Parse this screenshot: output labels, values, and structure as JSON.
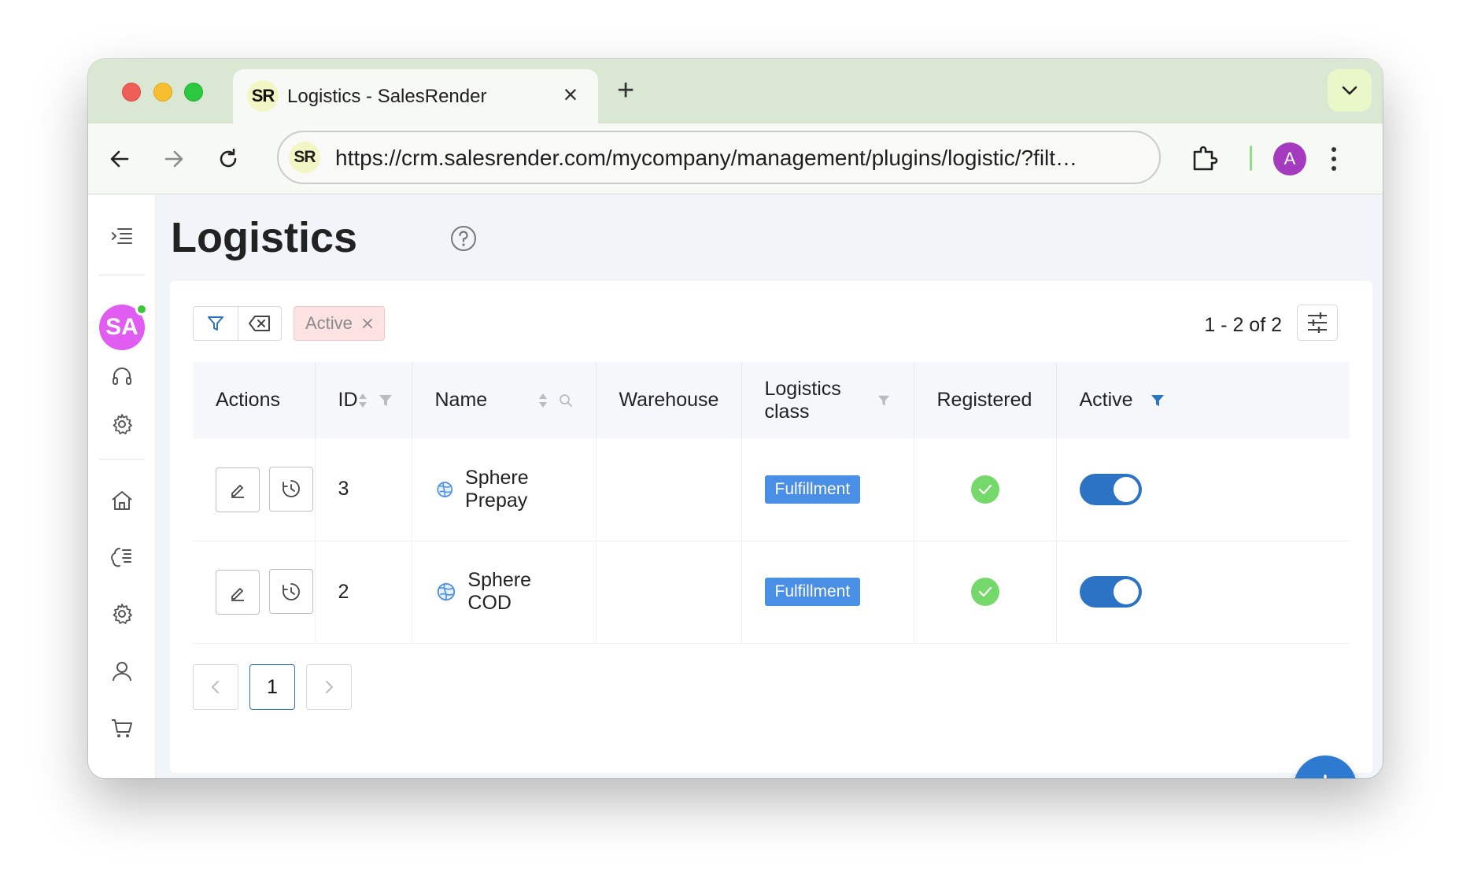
{
  "browser": {
    "tab": {
      "favicon_text": "SR",
      "title": "Logistics - SalesRender"
    },
    "new_tab_symbol": "+",
    "close_symbol": "×",
    "address": {
      "favicon_text": "SR",
      "url": "https://crm.salesrender.com/mycompany/management/plugins/logistic/?filt…"
    },
    "profile_initial": "A"
  },
  "sidebar": {
    "avatar_initials": "SA",
    "icons": [
      "menu-icon",
      "headset-icon",
      "gear-icon",
      "home-icon",
      "plugin-icon",
      "gear-icon",
      "user-icon",
      "cart-icon"
    ]
  },
  "page": {
    "title": "Logistics"
  },
  "filters": {
    "chip_label": "Active",
    "range_text": "1 - 2 of 2"
  },
  "table": {
    "headers": {
      "actions": "Actions",
      "id": "ID",
      "name": "Name",
      "warehouse": "Warehouse",
      "logistics_class": "Logistics class",
      "registered": "Registered",
      "active": "Active"
    },
    "rows": [
      {
        "id": "3",
        "name": "Sphere Prepay",
        "warehouse": "",
        "logistics_class": "Fulfillment",
        "registered": true,
        "active": true
      },
      {
        "id": "2",
        "name": "Sphere COD",
        "warehouse": "",
        "logistics_class": "Fulfillment",
        "registered": true,
        "active": true
      }
    ]
  },
  "pagination": {
    "current_page": "1"
  },
  "colors": {
    "accent": "#2c72c5",
    "badge": "#4a8fe6",
    "success": "#75d86a",
    "chip_bg": "#fde2e2",
    "tabstrip": "#dae8d3"
  }
}
